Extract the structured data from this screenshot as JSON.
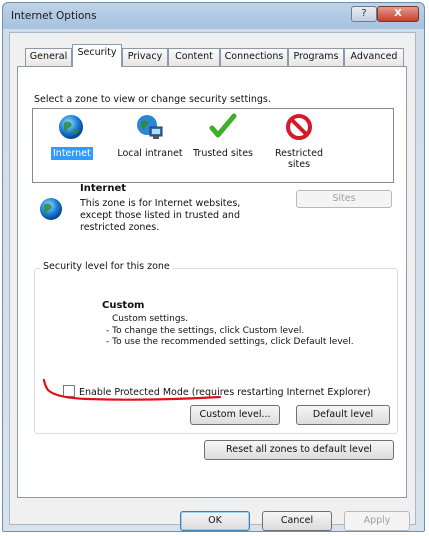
{
  "window": {
    "title": "Internet Options",
    "help_symbol": "?",
    "close_symbol": "X"
  },
  "tabs": [
    {
      "label": "General",
      "active": false
    },
    {
      "label": "Security",
      "active": true
    },
    {
      "label": "Privacy",
      "active": false
    },
    {
      "label": "Content",
      "active": false
    },
    {
      "label": "Connections",
      "active": false
    },
    {
      "label": "Programs",
      "active": false
    },
    {
      "label": "Advanced",
      "active": false
    }
  ],
  "zones": {
    "prompt": "Select a zone to view or change security settings.",
    "items": [
      {
        "label": "Internet",
        "icon": "globe-icon",
        "selected": true
      },
      {
        "label": "Local intranet",
        "icon": "intranet-icon",
        "selected": false
      },
      {
        "label": "Trusted sites",
        "icon": "checkmark-icon",
        "selected": false
      },
      {
        "label": "Restricted sites",
        "icon": "restricted-icon",
        "selected": false
      }
    ]
  },
  "zone_info": {
    "title": "Internet",
    "description": "This zone is for Internet websites, except those listed in trusted and restricted zones.",
    "sites_button": "Sites"
  },
  "security_level": {
    "group_title": "Security level for this zone",
    "level_name": "Custom",
    "lines": [
      "Custom settings.",
      "- To change the settings, click Custom level.",
      "- To use the recommended settings, click Default level."
    ],
    "protected_mode_label": "Enable Protected Mode (requires restarting Internet Explorer)",
    "protected_mode_checked": false,
    "custom_level_button": "Custom level...",
    "default_level_button": "Default level",
    "reset_all_button": "Reset all zones to default level"
  },
  "footer": {
    "ok": "OK",
    "cancel": "Cancel",
    "apply": "Apply"
  },
  "colors": {
    "selection": "#3399ff",
    "annotation_red": "#e0101a"
  }
}
